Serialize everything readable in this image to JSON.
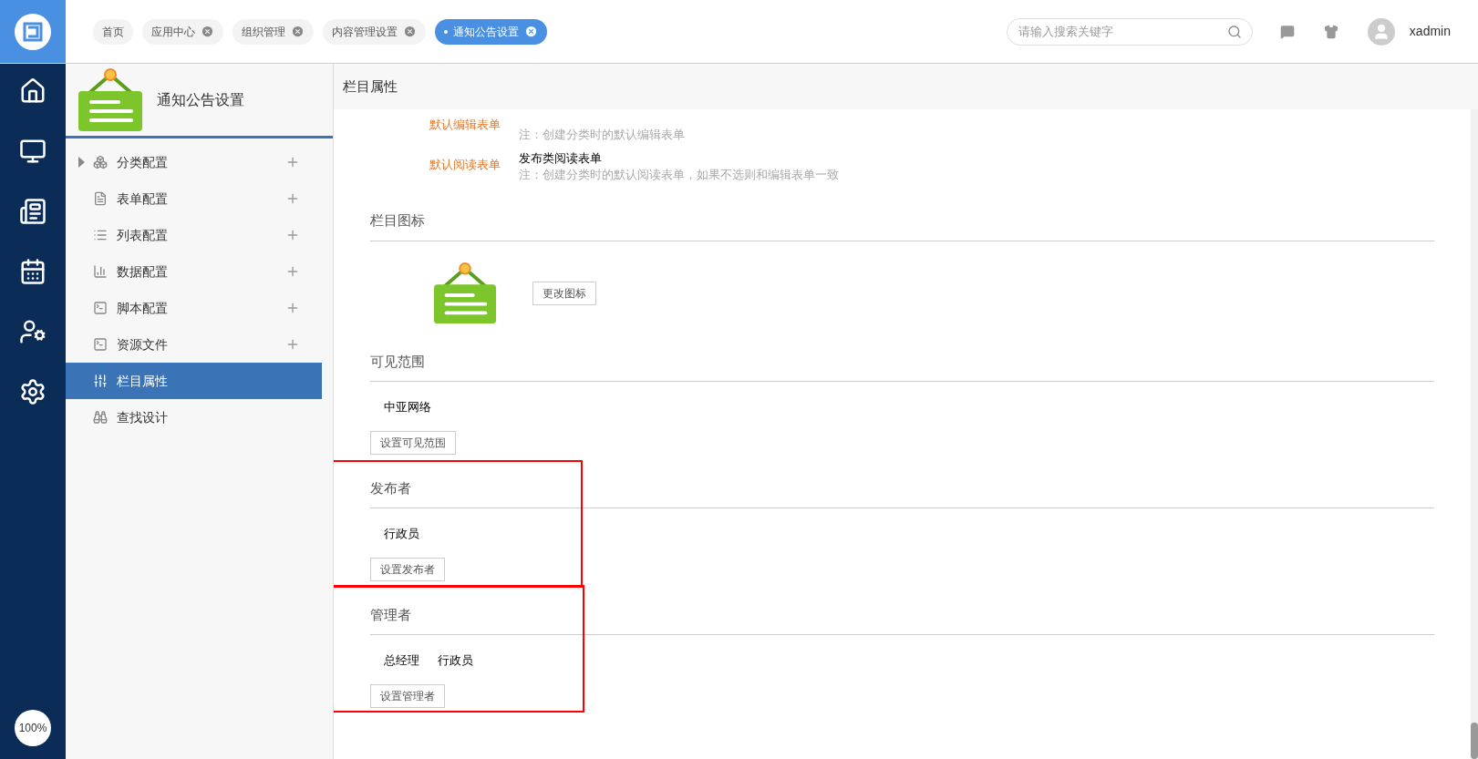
{
  "tabs": [
    {
      "label": "首页",
      "closable": false,
      "selected": false
    },
    {
      "label": "应用中心",
      "closable": true,
      "selected": false
    },
    {
      "label": "组织管理",
      "closable": true,
      "selected": false
    },
    {
      "label": "内容管理设置",
      "closable": true,
      "selected": false
    },
    {
      "label": "通知公告设置",
      "closable": true,
      "selected": true
    }
  ],
  "search": {
    "placeholder": "请输入搜索关键字"
  },
  "user": {
    "name": "xadmin"
  },
  "rail": {
    "zoom": "100%"
  },
  "sidebar": {
    "title": "通知公告设置",
    "items": [
      {
        "label": "分类配置",
        "expandable": true,
        "addable": true,
        "selected": false
      },
      {
        "label": "表单配置",
        "expandable": false,
        "addable": true,
        "selected": false
      },
      {
        "label": "列表配置",
        "expandable": false,
        "addable": true,
        "selected": false
      },
      {
        "label": "数据配置",
        "expandable": false,
        "addable": true,
        "selected": false
      },
      {
        "label": "脚本配置",
        "expandable": false,
        "addable": true,
        "selected": false
      },
      {
        "label": "资源文件",
        "expandable": false,
        "addable": true,
        "selected": false
      },
      {
        "label": "栏目属性",
        "expandable": false,
        "addable": false,
        "selected": true
      },
      {
        "label": "查找设计",
        "expandable": false,
        "addable": false,
        "selected": false
      }
    ]
  },
  "content": {
    "title": "栏目属性",
    "forms": [
      {
        "label": "默认编辑表单",
        "note": "注：创建分类时的默认编辑表单"
      },
      {
        "label": "默认阅读表单",
        "value": "发布类阅读表单",
        "note": "注：创建分类时的默认阅读表单，如果不选则和编辑表单一致"
      }
    ],
    "icon_section": {
      "title": "栏目图标",
      "button": "更改图标"
    },
    "sections": [
      {
        "title": "可见范围",
        "members": [
          "中亚网络"
        ],
        "button": "设置可见范围",
        "highlighted": false
      },
      {
        "title": "发布者",
        "members": [
          "行政员"
        ],
        "button": "设置发布者",
        "highlighted": true
      },
      {
        "title": "管理者",
        "members": [
          "总经理",
          "行政员"
        ],
        "button": "设置管理者",
        "highlighted": true
      }
    ]
  }
}
